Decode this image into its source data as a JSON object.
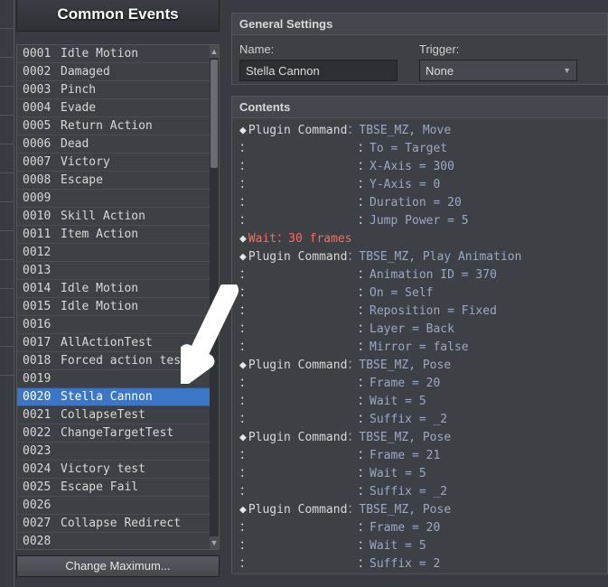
{
  "leftPanel": {
    "title": "Common Events",
    "changeMax": "Change Maximum...",
    "selectedIndex": 19,
    "items": [
      {
        "num": "0001",
        "name": "Idle Motion"
      },
      {
        "num": "0002",
        "name": "Damaged"
      },
      {
        "num": "0003",
        "name": "Pinch"
      },
      {
        "num": "0004",
        "name": "Evade"
      },
      {
        "num": "0005",
        "name": "Return Action"
      },
      {
        "num": "0006",
        "name": "Dead"
      },
      {
        "num": "0007",
        "name": "Victory"
      },
      {
        "num": "0008",
        "name": "Escape"
      },
      {
        "num": "0009",
        "name": ""
      },
      {
        "num": "0010",
        "name": "Skill Action"
      },
      {
        "num": "0011",
        "name": "Item Action"
      },
      {
        "num": "0012",
        "name": ""
      },
      {
        "num": "0013",
        "name": ""
      },
      {
        "num": "0014",
        "name": "Idle Motion"
      },
      {
        "num": "0015",
        "name": "Idle Motion"
      },
      {
        "num": "0016",
        "name": ""
      },
      {
        "num": "0017",
        "name": "AllActionTest"
      },
      {
        "num": "0018",
        "name": "Forced action test"
      },
      {
        "num": "0019",
        "name": ""
      },
      {
        "num": "0020",
        "name": "Stella Cannon"
      },
      {
        "num": "0021",
        "name": "CollapseTest"
      },
      {
        "num": "0022",
        "name": "ChangeTargetTest"
      },
      {
        "num": "0023",
        "name": ""
      },
      {
        "num": "0024",
        "name": "Victory test"
      },
      {
        "num": "0025",
        "name": "Escape Fail"
      },
      {
        "num": "0026",
        "name": ""
      },
      {
        "num": "0027",
        "name": "Collapse Redirect"
      },
      {
        "num": "0028",
        "name": ""
      }
    ]
  },
  "generalSettings": {
    "title": "General Settings",
    "nameLabel": "Name:",
    "name": "Stella Cannon",
    "triggerLabel": "Trigger:",
    "trigger": "None"
  },
  "contents": {
    "title": "Contents",
    "lines": [
      {
        "type": "plugin",
        "label": "Plugin Command",
        "args": "TBSE_MZ, Move"
      },
      {
        "type": "sub",
        "args": "To = Target"
      },
      {
        "type": "sub",
        "args": "X-Axis = 300"
      },
      {
        "type": "sub",
        "args": "Y-Axis = 0"
      },
      {
        "type": "sub",
        "args": "Duration = 20"
      },
      {
        "type": "sub",
        "args": "Jump Power = 5"
      },
      {
        "type": "wait",
        "text": "Wait：30 frames"
      },
      {
        "type": "plugin",
        "label": "Plugin Command",
        "args": "TBSE_MZ, Play Animation"
      },
      {
        "type": "sub",
        "args": "Animation ID = 370"
      },
      {
        "type": "sub",
        "args": "On = Self"
      },
      {
        "type": "sub",
        "args": "Reposition = Fixed"
      },
      {
        "type": "sub",
        "args": "Layer = Back"
      },
      {
        "type": "sub",
        "args": "Mirror = false"
      },
      {
        "type": "plugin",
        "label": "Plugin Command",
        "args": "TBSE_MZ, Pose"
      },
      {
        "type": "sub",
        "args": "Frame = 20"
      },
      {
        "type": "sub",
        "args": "Wait = 5"
      },
      {
        "type": "sub",
        "args": "Suffix = _2"
      },
      {
        "type": "plugin",
        "label": "Plugin Command",
        "args": "TBSE_MZ, Pose"
      },
      {
        "type": "sub",
        "args": "Frame = 21"
      },
      {
        "type": "sub",
        "args": "Wait = 5"
      },
      {
        "type": "sub",
        "args": "Suffix = _2"
      },
      {
        "type": "plugin",
        "label": "Plugin Command",
        "args": "TBSE_MZ, Pose"
      },
      {
        "type": "sub",
        "args": "Frame = 20"
      },
      {
        "type": "sub",
        "args": "Wait = 5"
      },
      {
        "type": "sub",
        "args": "Suffix =  2"
      }
    ]
  }
}
